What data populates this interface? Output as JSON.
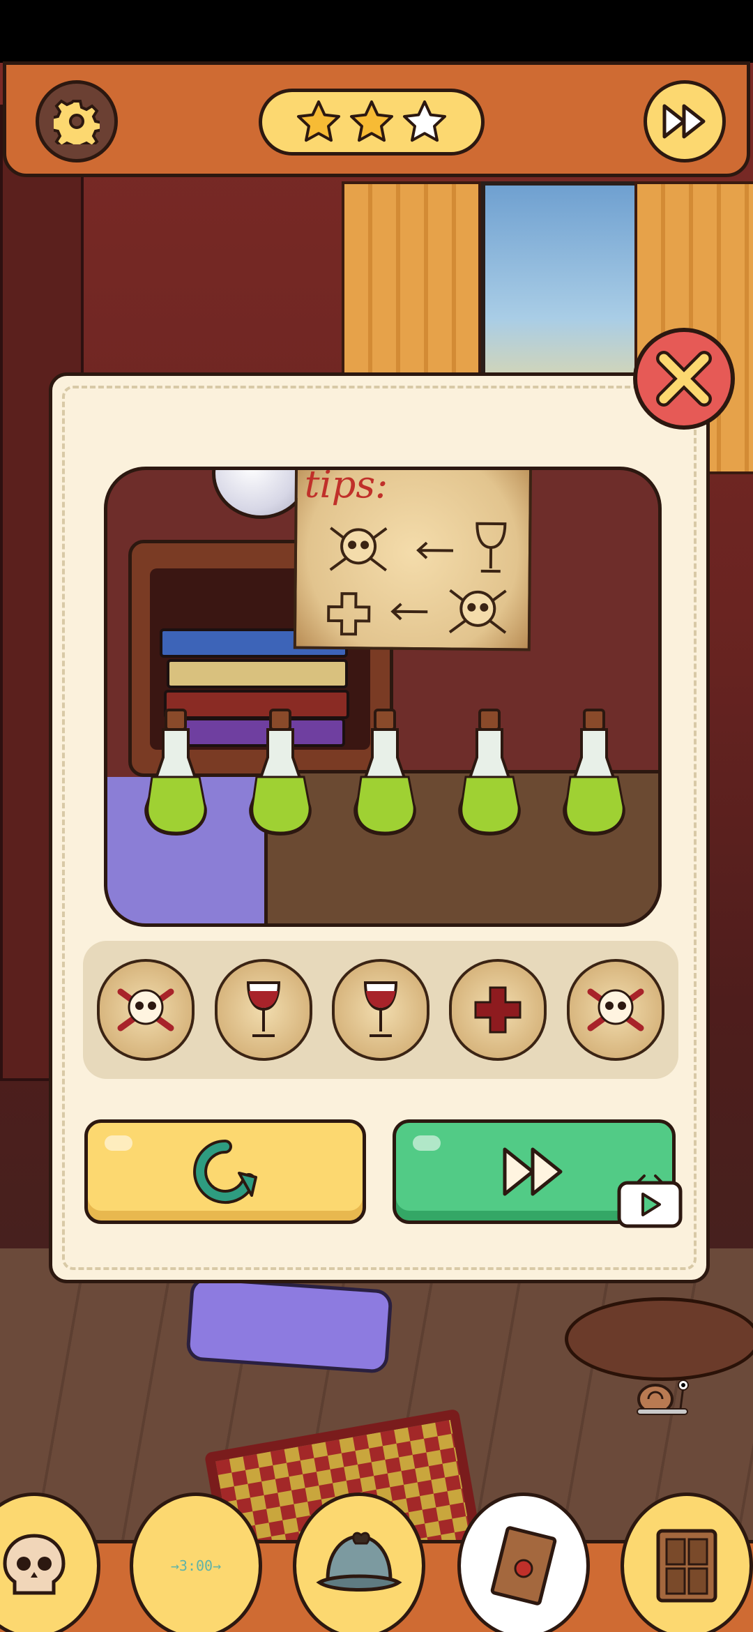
{
  "top_bar": {
    "settings_icon": "gear-icon",
    "stars": {
      "earned": 2,
      "total": 3
    },
    "skip_icon": "fast-forward-icon"
  },
  "dialog": {
    "close_icon": "close-x-icon",
    "clue_note": {
      "title": "tips:",
      "rows": [
        [
          "skull-crossbones",
          "arrow-left",
          "wine-glass"
        ],
        [
          "cross",
          "arrow-left",
          "skull-crossbones"
        ]
      ]
    },
    "potions": {
      "count": 5,
      "liquid_color": "#9fd133"
    },
    "answer_slots": [
      "skull-crossbones-icon",
      "wine-glass-icon",
      "wine-glass-icon",
      "red-cross-icon",
      "skull-crossbones-icon"
    ],
    "buttons": {
      "reset_icon": "reset-rotate-icon",
      "skip_icon": "fast-forward-icon",
      "skip_badge": "video-ad-icon"
    }
  },
  "inventory": {
    "items": [
      {
        "icon": "skull-item-icon",
        "selected": false
      },
      {
        "icon": "clock-hint-icon",
        "text": "→3:00→",
        "selected": false
      },
      {
        "icon": "detective-hat-icon",
        "selected": false
      },
      {
        "icon": "envelope-icon",
        "selected": true
      },
      {
        "icon": "cabinet-icon",
        "selected": false
      }
    ]
  },
  "colors": {
    "top_bar": "#cf6b33",
    "pill_yellow": "#fcd870",
    "close_red": "#e65a56",
    "skip_green": "#52cb86",
    "tips_red": "#c0302a"
  }
}
